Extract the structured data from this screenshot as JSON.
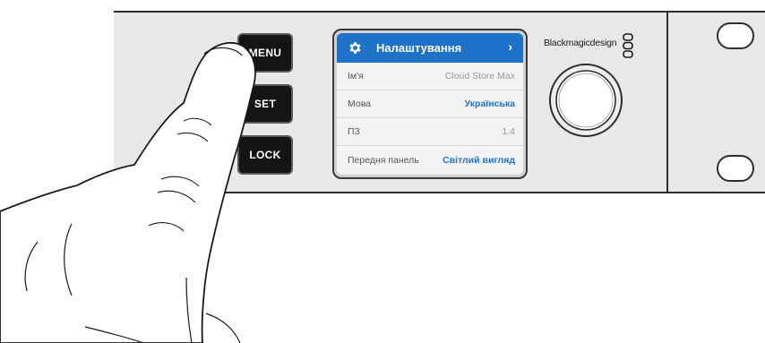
{
  "buttons": {
    "menu": "MENU",
    "set": "SET",
    "lock": "LOCK"
  },
  "lcd": {
    "title": "Налаштування",
    "chevron": "›",
    "rows": [
      {
        "label": "Ім'я",
        "value": "Cloud Store Max",
        "accent": false
      },
      {
        "label": "Мова",
        "value": "Українська",
        "accent": true
      },
      {
        "label": "ПЗ",
        "value": "1.4",
        "accent": false
      },
      {
        "label": "Передня панель",
        "value": "Світлий вигляд",
        "accent": true
      }
    ]
  },
  "brand": {
    "name": "Blackmagicdesign"
  },
  "icons": {
    "header": "gear-icon",
    "logo": "blackmagic-logo-icon",
    "knob": "rotary-knob-icon"
  },
  "colors": {
    "accent": "#1e73c8",
    "panel": "#e7e8ea",
    "button": "#141414"
  }
}
